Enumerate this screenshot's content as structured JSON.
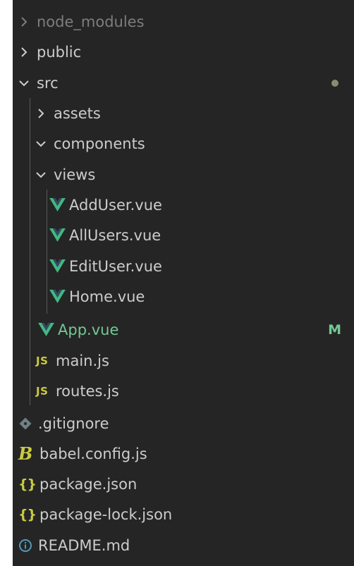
{
  "explorer": {
    "items": [
      {
        "label": "node_modules",
        "type": "folder",
        "state": "collapsed",
        "depth": 0,
        "muted": true
      },
      {
        "label": "public",
        "type": "folder",
        "state": "collapsed",
        "depth": 0
      },
      {
        "label": "src",
        "type": "folder",
        "state": "expanded",
        "depth": 0,
        "status": "modified-dot"
      },
      {
        "label": "assets",
        "type": "folder",
        "state": "collapsed",
        "depth": 1
      },
      {
        "label": "components",
        "type": "folder",
        "state": "expanded",
        "depth": 1
      },
      {
        "label": "views",
        "type": "folder",
        "state": "expanded",
        "depth": 1
      },
      {
        "label": "AddUser.vue",
        "type": "vue-file",
        "depth": 2
      },
      {
        "label": "AllUsers.vue",
        "type": "vue-file",
        "depth": 2
      },
      {
        "label": "EditUser.vue",
        "type": "vue-file",
        "depth": 2
      },
      {
        "label": "Home.vue",
        "type": "vue-file",
        "depth": 2
      },
      {
        "label": "App.vue",
        "type": "vue-file",
        "depth": 1,
        "status": "M"
      },
      {
        "label": "main.js",
        "type": "js-file",
        "depth": 1,
        "icon_text": "JS"
      },
      {
        "label": "routes.js",
        "type": "js-file",
        "depth": 1,
        "icon_text": "JS"
      },
      {
        "label": ".gitignore",
        "type": "git-file",
        "depth": 0
      },
      {
        "label": "babel.config.js",
        "type": "babel-file",
        "depth": 0,
        "icon_text": "B"
      },
      {
        "label": "package.json",
        "type": "json-file",
        "depth": 0,
        "icon_text": "{}"
      },
      {
        "label": "package-lock.json",
        "type": "json-file",
        "depth": 0,
        "icon_text": "{}"
      },
      {
        "label": "README.md",
        "type": "info-file",
        "depth": 0
      }
    ],
    "colors": {
      "background": "#252526",
      "text": "#cccccc",
      "muted_text": "#7d7d7d",
      "modified_text": "#73c991",
      "vue_icon": "#41b883",
      "js_icon": "#cbcb41",
      "json_icon": "#cbcb41",
      "git_icon": "#6d8086",
      "info_icon": "#519aba",
      "modified_dot": "#8b8b6e"
    }
  }
}
